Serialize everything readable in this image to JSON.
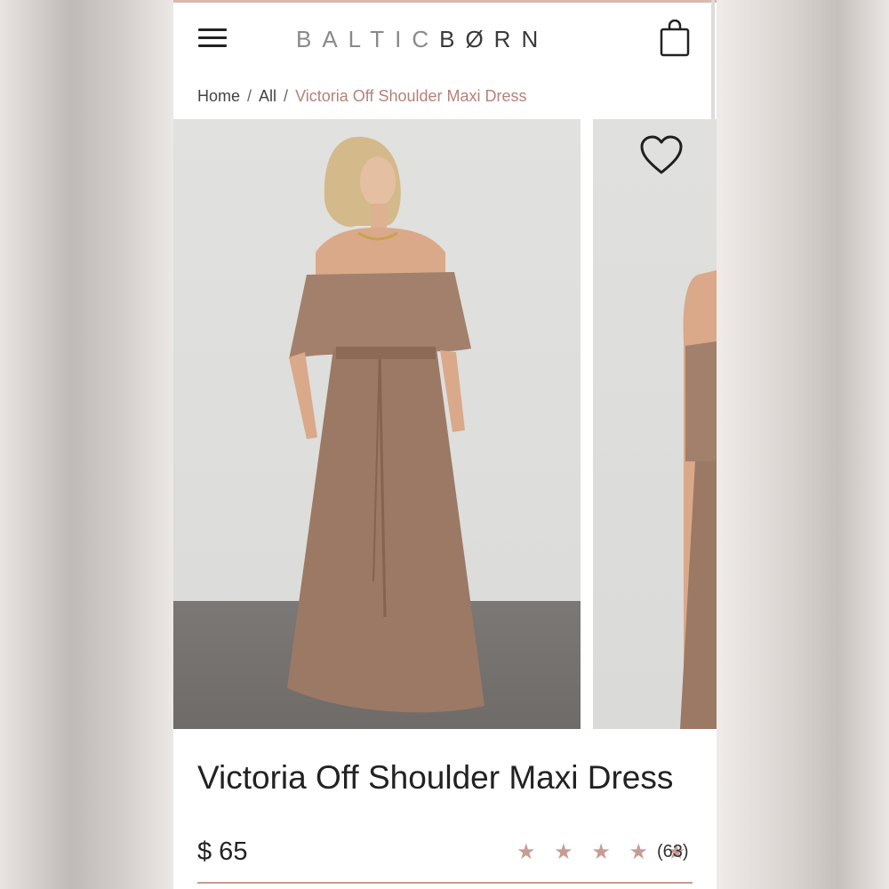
{
  "header": {
    "logo_part1": "BALTIC",
    "logo_part2": "BØRN",
    "menu_icon": "hamburger-menu-icon",
    "cart_icon": "shopping-bag-icon"
  },
  "breadcrumb": {
    "items": [
      "Home",
      "All"
    ],
    "separator": "/",
    "current": "Victoria Off Shoulder Maxi Dress"
  },
  "gallery": {
    "wishlist_icon": "heart-outline-icon",
    "image_subject": "model in mocha off-shoulder maxi dress"
  },
  "product": {
    "title": "Victoria Off Shoulder Maxi Dress",
    "price": "$ 65",
    "rating": 5,
    "review_count": "(63)",
    "stars": "★ ★ ★ ★ ★"
  },
  "colors": {
    "accent": "#b5817b",
    "stars": "#c79c93",
    "dress": "#9c7965"
  }
}
